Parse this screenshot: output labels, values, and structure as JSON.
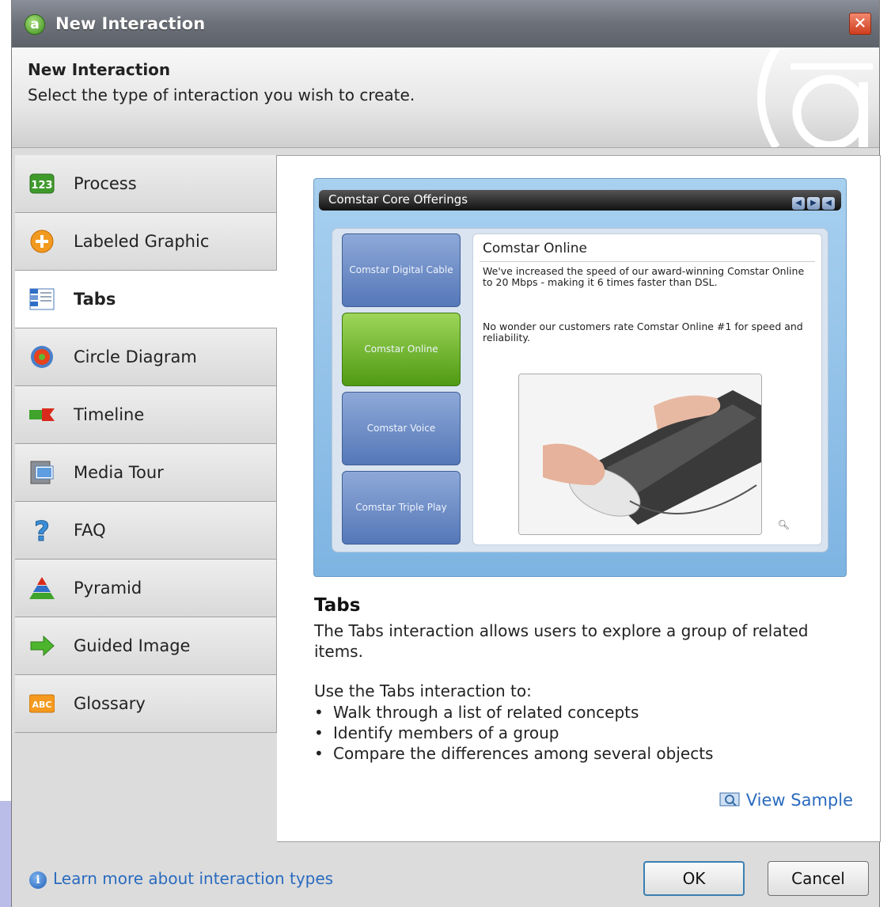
{
  "window": {
    "title": "New Interaction",
    "close_glyph": "✕",
    "logo_glyph": "a"
  },
  "header": {
    "title": "New Interaction",
    "subtitle": "Select the type of interaction you wish to create.",
    "brand_icon": "articulate-a-logo"
  },
  "sidebar": {
    "items": [
      {
        "label": "Process",
        "icon": "process-123-icon"
      },
      {
        "label": "Labeled Graphic",
        "icon": "labeled-graphic-icon"
      },
      {
        "label": "Tabs",
        "icon": "tabs-icon",
        "selected": true
      },
      {
        "label": "Circle Diagram",
        "icon": "circle-diagram-icon"
      },
      {
        "label": "Timeline",
        "icon": "timeline-icon"
      },
      {
        "label": "Media Tour",
        "icon": "media-tour-icon"
      },
      {
        "label": "FAQ",
        "icon": "question-mark-icon"
      },
      {
        "label": "Pyramid",
        "icon": "pyramid-icon"
      },
      {
        "label": "Guided Image",
        "icon": "arrow-right-icon"
      },
      {
        "label": "Glossary",
        "icon": "abc-icon"
      }
    ]
  },
  "preview": {
    "title": "Comstar Core Offerings",
    "tabs": [
      "Comstar Digital Cable",
      "Comstar Online",
      "Comstar Voice",
      "Comstar Triple Play"
    ],
    "selected_tab": 1,
    "pane_title": "Comstar Online",
    "pane_p1": "We've increased the speed of our award-winning Comstar Online to 20 Mbps - making it 6 times faster than DSL.",
    "pane_p2": "No wonder our customers rate Comstar Online #1 for speed and reliability."
  },
  "description": {
    "title": "Tabs",
    "text": "The Tabs interaction allows users to explore a group of related items.",
    "lead": "Use the Tabs interaction to:",
    "bullets": [
      "Walk through a list of related concepts",
      "Identify members of a group",
      "Compare the differences among several objects"
    ],
    "view_sample": "View Sample"
  },
  "footer": {
    "learn_more": "Learn more about interaction types",
    "ok_label": "OK",
    "cancel_label": "Cancel"
  },
  "colors": {
    "link": "#2a6bbf",
    "selected_tab": "#4f9a12",
    "tab_blue": "#5577b8"
  }
}
